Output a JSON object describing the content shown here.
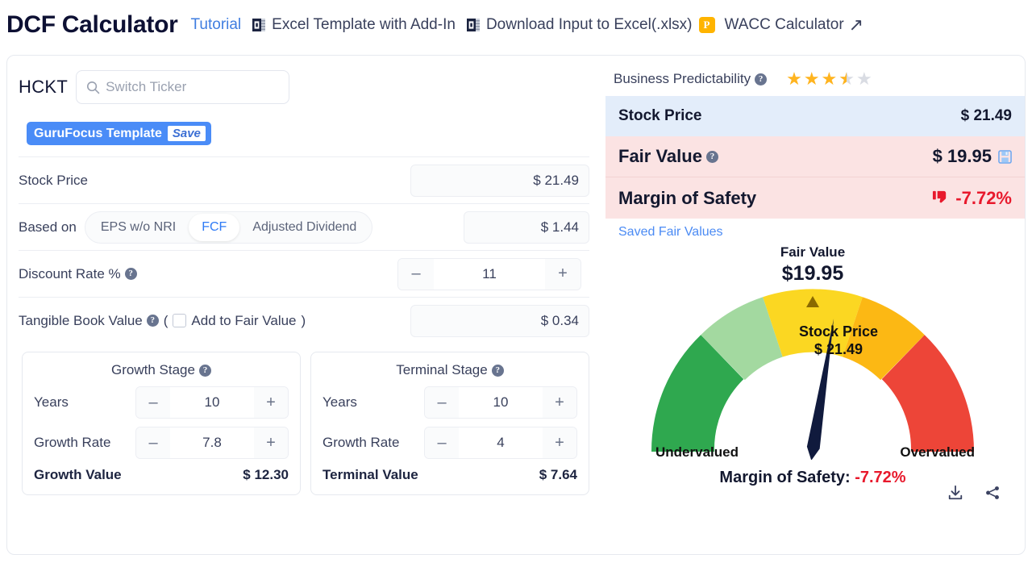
{
  "header": {
    "title": "DCF Calculator",
    "tutorial": "Tutorial",
    "excel_template": "Excel Template with Add-In",
    "download_input": "Download Input to Excel(.xlsx)",
    "premium_badge": "P",
    "wacc": "WACC Calculator",
    "excel_icon": "excel-icon",
    "external-link-icon": "↗"
  },
  "left": {
    "ticker": "HCKT",
    "search_placeholder": "Switch Ticker",
    "search_icon": "search-icon",
    "template_name": "GuruFocus Template",
    "template_save": "Save",
    "stock_price_label": "Stock Price",
    "stock_price_value": "$ 21.49",
    "based_on_label": "Based on",
    "based_on_options": [
      "EPS w/o NRI",
      "FCF",
      "Adjusted Dividend"
    ],
    "based_on_selected": "FCF",
    "based_on_value": "$ 1.44",
    "discount_rate_label": "Discount Rate %",
    "discount_rate_value": "11",
    "tangible_label": "Tangible Book Value",
    "tangible_paren_open": "(",
    "tangible_add_label": "Add to Fair Value",
    "tangible_paren_close": ")",
    "tangible_value": "$ 0.34",
    "minus": "–",
    "plus": "+",
    "growth_stage": {
      "title": "Growth Stage",
      "years_label": "Years",
      "years_value": "10",
      "rate_label": "Growth Rate",
      "rate_value": "7.8",
      "total_label": "Growth Value",
      "total_value": "$ 12.30"
    },
    "terminal_stage": {
      "title": "Terminal Stage",
      "years_label": "Years",
      "years_value": "10",
      "rate_label": "Growth Rate",
      "rate_value": "4",
      "total_label": "Terminal Value",
      "total_value": "$ 7.64"
    }
  },
  "right": {
    "predictability_label": "Business Predictability",
    "predictability_rating": 3.5,
    "predictability_max": 5,
    "stock_price_label": "Stock Price",
    "stock_price_value": "$ 21.49",
    "fair_value_label": "Fair Value",
    "fair_value_value": "$ 19.95",
    "save_icon": "save-icon",
    "margin_label": "Margin of Safety",
    "margin_value": "-7.72%",
    "thumbs_down_icon": "thumbs-down-icon",
    "saved_fair_values": "Saved Fair Values",
    "download_icon": "download-icon",
    "share_icon": "share-icon"
  },
  "chart_data": {
    "type": "gauge",
    "title": "Fair Value",
    "title_value": "$19.95",
    "needle_label": "Stock Price",
    "needle_value": "$ 21.49",
    "left_label": "Undervalued",
    "right_label": "Overvalued",
    "footer_label": "Margin of Safety:",
    "footer_value": "-7.72%",
    "marker_position_deg": 90,
    "needle_angle_deg": 97,
    "segments": [
      {
        "name": "strongly undervalued",
        "color": "#2fa84f",
        "start_deg": 180,
        "end_deg": 144
      },
      {
        "name": "undervalued",
        "color": "#a3d9a0",
        "start_deg": 144,
        "end_deg": 108
      },
      {
        "name": "fairly valued",
        "color": "#fbd722",
        "start_deg": 108,
        "end_deg": 72
      },
      {
        "name": "overvalued",
        "color": "#fcb814",
        "start_deg": 72,
        "end_deg": 36
      },
      {
        "name": "strongly overvalued",
        "color": "#ed4538",
        "start_deg": 36,
        "end_deg": 0
      }
    ]
  },
  "colors": {
    "accent_blue": "#4a8cf7",
    "link_blue": "#3f7de0",
    "negative_red": "#e8192c",
    "stock_row_bg": "#e3edfa",
    "fair_row_bg": "#fbe3e3",
    "premium_orange": "#ffb400",
    "star_gold": "#ffb41f"
  }
}
